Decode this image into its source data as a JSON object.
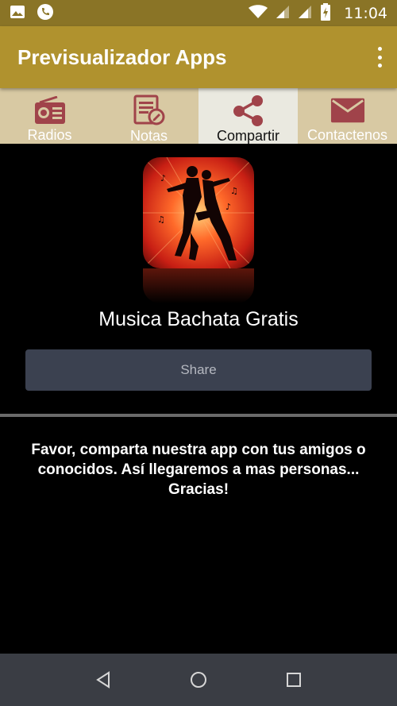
{
  "status_bar": {
    "time": "11:04",
    "icons": [
      "image-icon",
      "phone-icon",
      "wifi-icon",
      "signal-icon",
      "signal-icon",
      "battery-charging-icon"
    ]
  },
  "app_bar": {
    "title": "Previsualizador Apps",
    "overflow_icon": "more-vert-icon"
  },
  "tabs": [
    {
      "label": "Radios",
      "icon": "radio-icon",
      "active": false
    },
    {
      "label": "Notas",
      "icon": "notes-icon",
      "active": false
    },
    {
      "label": "Compartir",
      "icon": "share-icon",
      "active": true
    },
    {
      "label": "Contactenos",
      "icon": "mail-icon",
      "active": false
    }
  ],
  "content": {
    "app_name": "Musica Bachata Gratis",
    "share_label": "Share",
    "message": "Favor, comparta nuestra app con tus amigos o conocidos. Así llegaremos a mas personas... Gracias!"
  },
  "nav_bar": {
    "buttons": [
      "back-icon",
      "home-icon",
      "recents-icon"
    ]
  },
  "colors": {
    "status_bar": "#8a7426",
    "app_bar": "#b0922e",
    "tab_bg": "#d8c9a3",
    "tab_active_bg": "#eae9e0",
    "tab_icon": "#a0434a",
    "share_button": "#3b4150",
    "nav_bar": "#3a3d44"
  }
}
